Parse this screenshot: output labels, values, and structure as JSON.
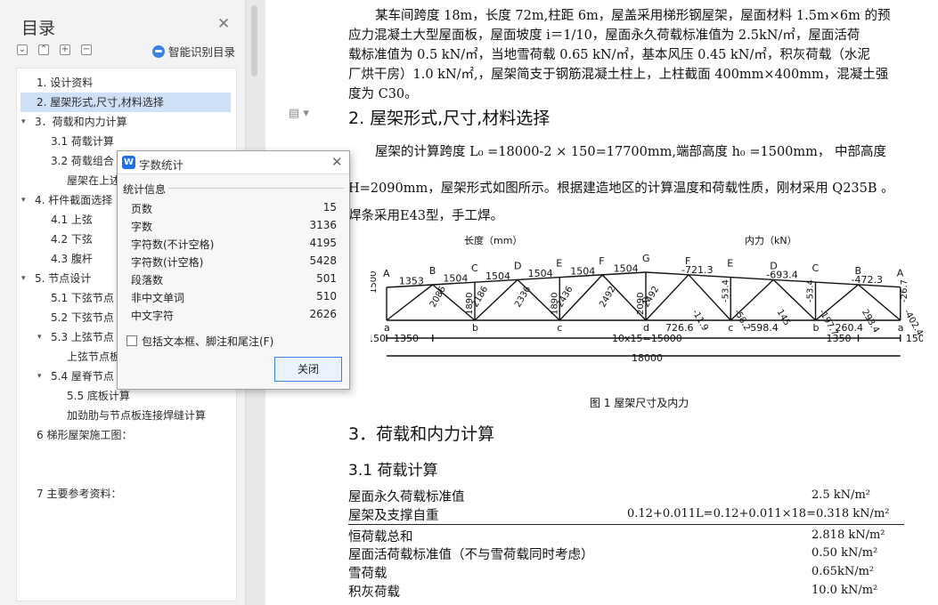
{
  "sidebar": {
    "title": "目录",
    "smart_toc_label": "智能识别目录",
    "items": [
      {
        "label": "1. 设计资料"
      },
      {
        "label": "2. 屋架形式,尺寸,材料选择"
      },
      {
        "label": "3．荷载和内力计算"
      },
      {
        "label": "3.1 荷载计算"
      },
      {
        "label": "3.2 荷载组合"
      },
      {
        "label": "屋架在上述"
      },
      {
        "label": "4. 杆件截面选择"
      },
      {
        "label": "4.1 上弦"
      },
      {
        "label": "4.2 下弦"
      },
      {
        "label": "4.3 腹杆"
      },
      {
        "label": "5. 节点设计"
      },
      {
        "label": "5.1 下弦节点"
      },
      {
        "label": "5.2 下弦节点"
      },
      {
        "label": "5.3 上弦节点"
      },
      {
        "label": "上弦节点板"
      },
      {
        "label": "5.4 屋脊节点"
      },
      {
        "label": "5.5 底板计算"
      },
      {
        "label": "加劲肋与节点板连接焊缝计算"
      },
      {
        "label": "6 梯形屋架施工图："
      },
      {
        "label": "7 主要参考资料："
      }
    ]
  },
  "dialog": {
    "title": "字数统计",
    "group_label": "统计信息",
    "stats": [
      {
        "label": "页数",
        "value": "15"
      },
      {
        "label": "字数",
        "value": "3136"
      },
      {
        "label": "字符数(不计空格)",
        "value": "4195"
      },
      {
        "label": "字符数(计空格)",
        "value": "5428"
      },
      {
        "label": "段落数",
        "value": "501"
      },
      {
        "label": "非中文单词",
        "value": "510"
      },
      {
        "label": "中文字符",
        "value": "2626"
      }
    ],
    "checkbox_label": "包括文本框、脚注和尾注(F)",
    "close_button": "关闭"
  },
  "document": {
    "para1": [
      "某车间跨度 18m，长度 72m,柱距 6m，屋盖采用梯形钢屋架，屋面材料 1.5m×6m 的预",
      "应力混凝土大型屋面板，屋面坡度 i＝1/10，屋面永久荷载标准值为 2.5kN/㎡，屋面活荷",
      "载标准值为 0.5 kN/㎡，当地雪荷载 0.65 kN/㎡，基本风压 0.45 kN/㎡，积灰荷载（水泥",
      "厂烘干房）1.0 kN/㎡,，屋架简支于钢筋混凝土柱上，上柱截面 400mm×400mm，混凝土强",
      "度为 C30。"
    ],
    "h2_section2": "2. 屋架形式,尺寸,材料选择",
    "para2_line1": "屋架的计算跨度 L₀ =18000-2 × 150=17700mm,端部高度 h₀ =1500mm， 中部高度",
    "para2_line2": "H=2090mm，屋架形式如图所示。根据建造地区的计算温度和荷载性质，刚材采用 Q235B 。",
    "para2_line3": "焊条采用E43型，手工焊。",
    "figure_caption": "图 1 屋架尺寸及内力",
    "h2_section3": "3．荷载和内力计算",
    "h3_section31": "3.1 荷载计算",
    "load_rows": [
      {
        "label": "屋面永久荷载标准值",
        "value": "2.5 kN/m²"
      },
      {
        "label": "屋架及支撑自重",
        "value": "0.12+0.011L=0.12+0.011×18=0.318 kN/m²"
      },
      {
        "label": "恒荷载总和",
        "value": "2.818 kN/m²"
      },
      {
        "label": "屋面活荷载标准值（不与雪荷载同时考虑）",
        "value": "0.50 kN/m²"
      },
      {
        "label": "雪荷载",
        "value": "0.65kN/m²"
      },
      {
        "label": "积灰荷载",
        "value": "10.0 kN/m²"
      }
    ]
  },
  "truss": {
    "len_label": "长度（mm）",
    "force_label": "内力（kN）",
    "top_nodes_left": [
      "A",
      "B",
      "C",
      "D",
      "E",
      "F",
      "G"
    ],
    "top_nodes_right": [
      "F",
      "E",
      "D",
      "C",
      "B",
      "A"
    ],
    "bottom_nodes": [
      "a",
      "b",
      "c",
      "d",
      "c",
      "b",
      "a"
    ],
    "top_lengths": [
      "1353",
      "1504",
      "1504",
      "1504",
      "1504",
      "1504"
    ],
    "top_forces": [
      "-721.3",
      "-693.4",
      "-472.3"
    ],
    "bottom_forces": [
      "726.6",
      "598.4",
      "260.4"
    ],
    "diag_lengths": [
      "2086",
      "2186",
      "2336",
      "2436",
      "2492",
      "2492"
    ],
    "vert_lengths": [
      "1890",
      "1890",
      "2090"
    ],
    "diag_forces": [
      "-11.9",
      "-58.2",
      "145",
      "-197.7",
      "293.4",
      "-402.4"
    ],
    "vert_forces": [
      "-53.4",
      "-53.4",
      "-26.7",
      "0"
    ],
    "end_height": "1500",
    "dims": [
      "150",
      "1350",
      "10x15=15000",
      "1350",
      "150"
    ],
    "span": "18000"
  }
}
